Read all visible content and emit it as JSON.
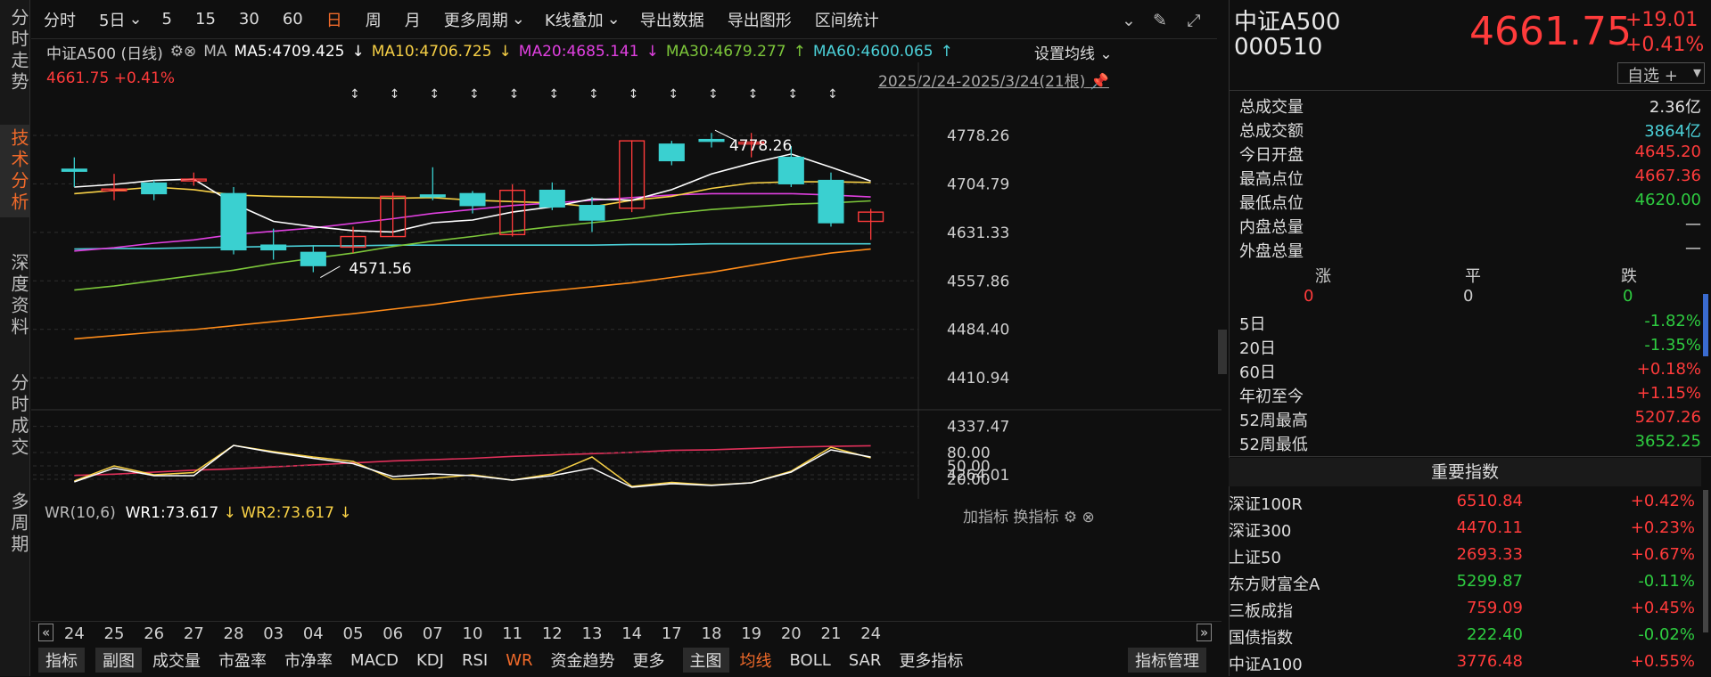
{
  "left_nav": [
    {
      "label": "分时走势",
      "active": false
    },
    {
      "label": "技术分析",
      "active": true
    },
    {
      "label": "深度资料",
      "active": false
    },
    {
      "label": "分时成交",
      "active": false
    },
    {
      "label": "多周期",
      "active": false
    }
  ],
  "toolbar": {
    "items": [
      "分时",
      "5日",
      "5",
      "15",
      "30",
      "60",
      "日",
      "周",
      "月",
      "更多周期",
      "K线叠加",
      "导出数据",
      "导出图形",
      "区间统计"
    ],
    "active": "日"
  },
  "chart_info": {
    "name": "中证A500 (日线)",
    "ma_label": "MA",
    "ma5": "MA5:4709.425",
    "ma10": "MA10:4706.725",
    "ma20": "MA20:4685.141",
    "ma30": "MA30:4679.277",
    "ma60": "MA60:4600.065",
    "price": "4661.75",
    "pct": "+0.41%",
    "range": "2025/2/24-2025/3/24(21根)",
    "set_ma": "设置均线",
    "hi_label": "4778.26",
    "lo_label": "4571.56"
  },
  "colors": {
    "up": "#ff3b3b",
    "down": "#2ecc40",
    "bear_fill": "#3ad0d0",
    "ma5": "#ffffff",
    "ma10": "#f7d046",
    "ma20": "#e040e0",
    "ma30": "#7cc63a",
    "ma60": "#4bd0d8",
    "maA": "#ff8c1a",
    "maB": "#e0305a",
    "accent": "#f06a2a"
  },
  "y_axis": [
    "4778.26",
    "4704.79",
    "4631.33",
    "4557.86",
    "4484.40",
    "4410.94",
    "4337.47",
    "4264.01"
  ],
  "chart_data": {
    "type": "candlestick",
    "x": [
      "24",
      "25",
      "26",
      "27",
      "28",
      "03",
      "04",
      "05",
      "06",
      "07",
      "10",
      "11",
      "12",
      "13",
      "14",
      "17",
      "18",
      "19",
      "20",
      "21",
      "24"
    ],
    "open": [
      4727,
      4695,
      4706,
      4710,
      4690,
      4612,
      4601,
      4609,
      4625,
      4688,
      4690,
      4628,
      4695,
      4672,
      4668,
      4765,
      4772,
      4768,
      4745,
      4710,
      4648
    ],
    "close": [
      4724,
      4697,
      4690,
      4712,
      4605,
      4605,
      4581,
      4625,
      4686,
      4686,
      4672,
      4695,
      4670,
      4650,
      4770,
      4740,
      4771,
      4768,
      4705,
      4646,
      4662
    ],
    "high": [
      4745,
      4720,
      4710,
      4722,
      4700,
      4637,
      4612,
      4640,
      4692,
      4730,
      4694,
      4704,
      4707,
      4685,
      4771,
      4770,
      4782,
      4782,
      4762,
      4722,
      4667
    ],
    "low": [
      4700,
      4680,
      4680,
      4702,
      4598,
      4590,
      4571,
      4600,
      4625,
      4680,
      4660,
      4625,
      4665,
      4632,
      4662,
      4733,
      4760,
      4745,
      4700,
      4640,
      4620
    ],
    "ma5": [
      4700,
      4704,
      4710,
      4712,
      4675,
      4648,
      4640,
      4634,
      4632,
      4646,
      4650,
      4662,
      4670,
      4682,
      4680,
      4696,
      4720,
      4736,
      4750,
      4730,
      4709
    ],
    "ma10": [
      4690,
      4695,
      4700,
      4696,
      4688,
      4686,
      4685,
      4684,
      4683,
      4684,
      4680,
      4678,
      4676,
      4670,
      4680,
      4686,
      4698,
      4706,
      4708,
      4708,
      4707
    ],
    "ma20": [
      4603,
      4608,
      4615,
      4620,
      4628,
      4633,
      4638,
      4645,
      4652,
      4660,
      4666,
      4672,
      4676,
      4680,
      4684,
      4688,
      4690,
      4690,
      4690,
      4688,
      4685
    ],
    "ma30": [
      4544,
      4550,
      4558,
      4566,
      4574,
      4584,
      4592,
      4600,
      4610,
      4618,
      4625,
      4633,
      4640,
      4646,
      4652,
      4660,
      4666,
      4670,
      4674,
      4676,
      4679
    ],
    "ma60": [
      4606,
      4607,
      4607,
      4608,
      4609,
      4610,
      4611,
      4611,
      4612,
      4612,
      4612,
      4612,
      4612,
      4612,
      4613,
      4613,
      4614,
      4614,
      4614,
      4614,
      4614
    ],
    "maA": [
      4470,
      4475,
      4480,
      4484,
      4490,
      4496,
      4502,
      4508,
      4515,
      4522,
      4530,
      4537,
      4543,
      4549,
      4555,
      4563,
      4571,
      4581,
      4591,
      4600,
      4606
    ],
    "maB": [
      4263,
      4265,
      4268,
      4271,
      4273,
      4276,
      4279,
      4282,
      4285,
      4287,
      4289,
      4292,
      4294,
      4296,
      4298,
      4301,
      4302,
      4304,
      4306,
      4307,
      4308
    ],
    "ylim": [
      4264.01,
      4778.26
    ],
    "wr_ticks": [
      "80.00",
      "50.00",
      "20.00"
    ],
    "wr1": [
      14,
      45,
      28,
      28,
      96,
      80,
      67,
      55,
      26,
      32,
      28,
      18,
      28,
      45,
      2,
      10,
      6,
      12,
      36,
      86,
      70
    ],
    "wr2": [
      16,
      50,
      30,
      35,
      96,
      82,
      70,
      60,
      20,
      22,
      30,
      18,
      32,
      70,
      4,
      13,
      7,
      12,
      38,
      92,
      68
    ]
  },
  "wr": {
    "title": "WR(10,6)",
    "wr1_label": "WR1:73.617",
    "wr2_label": "WR2:73.617",
    "add": "加指标",
    "switch": "换指标"
  },
  "bottom_tabs": [
    "指标",
    "副图",
    "成交量",
    "市盈率",
    "市净率",
    "MACD",
    "KDJ",
    "RSI",
    "WR",
    "资金趋势",
    "更多",
    "主图",
    "均线",
    "BOLL",
    "SAR",
    "更多指标"
  ],
  "bottom_manage": "指标管理",
  "quote": {
    "name": "中证A500",
    "code": "000510",
    "price": "4661.75",
    "change": "+19.01",
    "pct": "+0.41%",
    "select": "自选 +"
  },
  "stats": [
    {
      "label": "总成交量",
      "value": "2.36亿",
      "color": "white"
    },
    {
      "label": "总成交额",
      "value": "3864亿",
      "color": "#4bd0d8"
    },
    {
      "label": "今日开盘",
      "value": "4645.20",
      "color": "red"
    },
    {
      "label": "最高点位",
      "value": "4667.36",
      "color": "red"
    },
    {
      "label": "最低点位",
      "value": "4620.00",
      "color": "green"
    },
    {
      "label": "内盘总量",
      "value": "—",
      "color": "white"
    },
    {
      "label": "外盘总量",
      "value": "—",
      "color": "white"
    }
  ],
  "breadth": {
    "up_label": "涨",
    "flat_label": "平",
    "down_label": "跌",
    "up": "0",
    "flat": "0",
    "down": "0"
  },
  "perf": [
    {
      "label": "5日",
      "value": "-1.82%",
      "color": "green"
    },
    {
      "label": "20日",
      "value": "-1.35%",
      "color": "green"
    },
    {
      "label": "60日",
      "value": "+0.18%",
      "color": "red"
    },
    {
      "label": "年初至今",
      "value": "+1.15%",
      "color": "red"
    },
    {
      "label": "52周最高",
      "value": "5207.26",
      "color": "red"
    },
    {
      "label": "52周最低",
      "value": "3652.25",
      "color": "green"
    }
  ],
  "indices_title": "重要指数",
  "indices": [
    {
      "name": "深证100R",
      "value": "6510.84",
      "pct": "+0.42%",
      "color": "red"
    },
    {
      "name": "深证300",
      "value": "4470.11",
      "pct": "+0.23%",
      "color": "red"
    },
    {
      "name": "上证50",
      "value": "2693.33",
      "pct": "+0.67%",
      "color": "red"
    },
    {
      "name": "东方财富全A",
      "value": "5299.87",
      "pct": "-0.11%",
      "color": "green"
    },
    {
      "name": "三板成指",
      "value": "759.09",
      "pct": "+0.45%",
      "color": "red"
    },
    {
      "name": "国债指数",
      "value": "222.40",
      "pct": "-0.02%",
      "color": "green"
    },
    {
      "name": "中证A100",
      "value": "3776.48",
      "pct": "+0.55%",
      "color": "red"
    }
  ]
}
